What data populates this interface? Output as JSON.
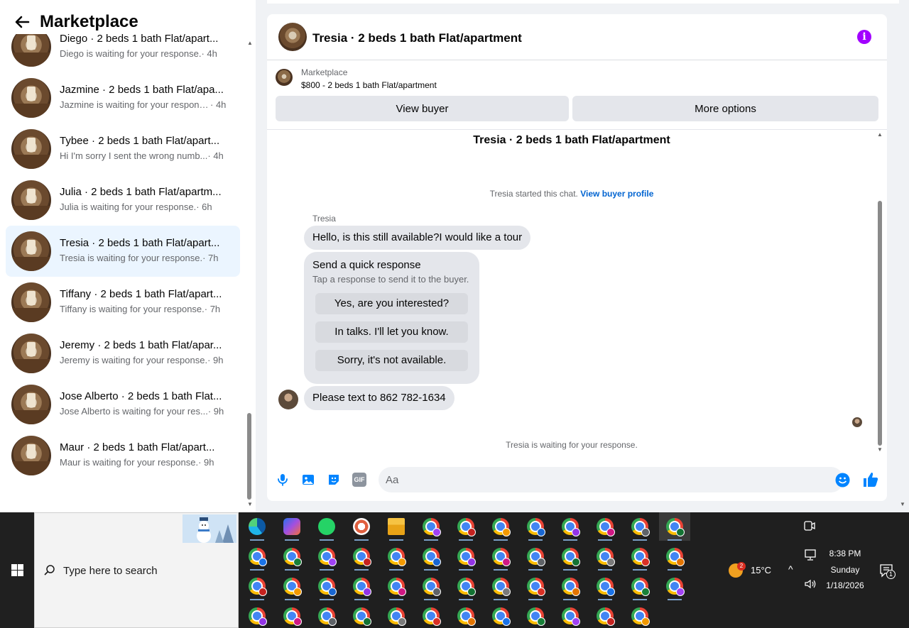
{
  "sidebar": {
    "title": "Marketplace",
    "conversations": [
      {
        "title": "Diego · 2 beds 1 bath Flat/apart...",
        "snippet": "Diego is waiting for your response.",
        "time": "· 4h"
      },
      {
        "title": "Jazmine · 2 beds 1 bath Flat/apa...",
        "snippet": "Jazmine is waiting for your response.",
        "time": "· 4h"
      },
      {
        "title": "Tybee · 2 beds 1 bath Flat/apart...",
        "snippet": "Hi I'm sorry I sent the wrong numb...",
        "time": "· 4h"
      },
      {
        "title": "Julia · 2 beds 1 bath Flat/apartm...",
        "snippet": "Julia is waiting for your response.",
        "time": "· 6h"
      },
      {
        "title": "Tresia · 2 beds 1 bath Flat/apart...",
        "snippet": "Tresia is waiting for your response.",
        "time": "· 7h"
      },
      {
        "title": "Tiffany · 2 beds 1 bath Flat/apart...",
        "snippet": "Tiffany is waiting for your response.",
        "time": "· 7h"
      },
      {
        "title": "Jeremy · 2 beds 1 bath Flat/apar...",
        "snippet": "Jeremy is waiting for your response.",
        "time": "· 9h"
      },
      {
        "title": "Jose Alberto · 2 beds 1 bath Flat...",
        "snippet": "Jose Alberto is waiting for your res...",
        "time": "· 9h"
      },
      {
        "title": "Maur · 2 beds 1 bath Flat/apart...",
        "snippet": "Maur is waiting for your response.",
        "time": "· 9h"
      }
    ],
    "active_index": 4
  },
  "chat": {
    "header_title": "Tresia · 2 beds 1 bath Flat/apartment",
    "listing_label": "Marketplace",
    "listing_price": "$800 - 2 beds 1 bath Flat/apartment",
    "view_buyer_label": "View buyer",
    "more_options_label": "More options",
    "messages_heading": "Tresia · 2 beds 1 bath Flat/apartment",
    "started_text": "Tresia started this chat.",
    "view_buyer_profile": "View buyer profile",
    "sender_name": "Tresia",
    "message1": "Hello, is this still available?I would like a tour",
    "quick_title": "Send a quick response",
    "quick_subtitle": "Tap a response to send it to the buyer.",
    "quick_replies": [
      "Yes, are you interested?",
      "In talks. I'll let you know.",
      "Sorry, it's not available."
    ],
    "message2": "Please text to 862 782-1634",
    "waiting_text": "Tresia is waiting for your response.",
    "input_placeholder": "Aa",
    "gif_label": "GIF",
    "accent_color": "#a200ff",
    "link_color": "#0064d1",
    "like_color": "#0084ff"
  },
  "taskbar": {
    "search_placeholder": "Type here to search",
    "apps_row1": [
      "edge-icon",
      "copilot-icon",
      "whatsapp-icon",
      "paint-icon",
      "file-explorer-icon",
      "chrome-icon",
      "chrome-icon",
      "chrome-icon",
      "chrome-icon",
      "chrome-icon",
      "chrome-icon",
      "chrome-icon",
      "chrome-icon"
    ],
    "chrome_rows": 3,
    "temperature": "15°C",
    "weather_badge": "2",
    "time": "8:38 PM",
    "day": "Sunday",
    "date": "1/18/2026",
    "notification_count": "1"
  }
}
